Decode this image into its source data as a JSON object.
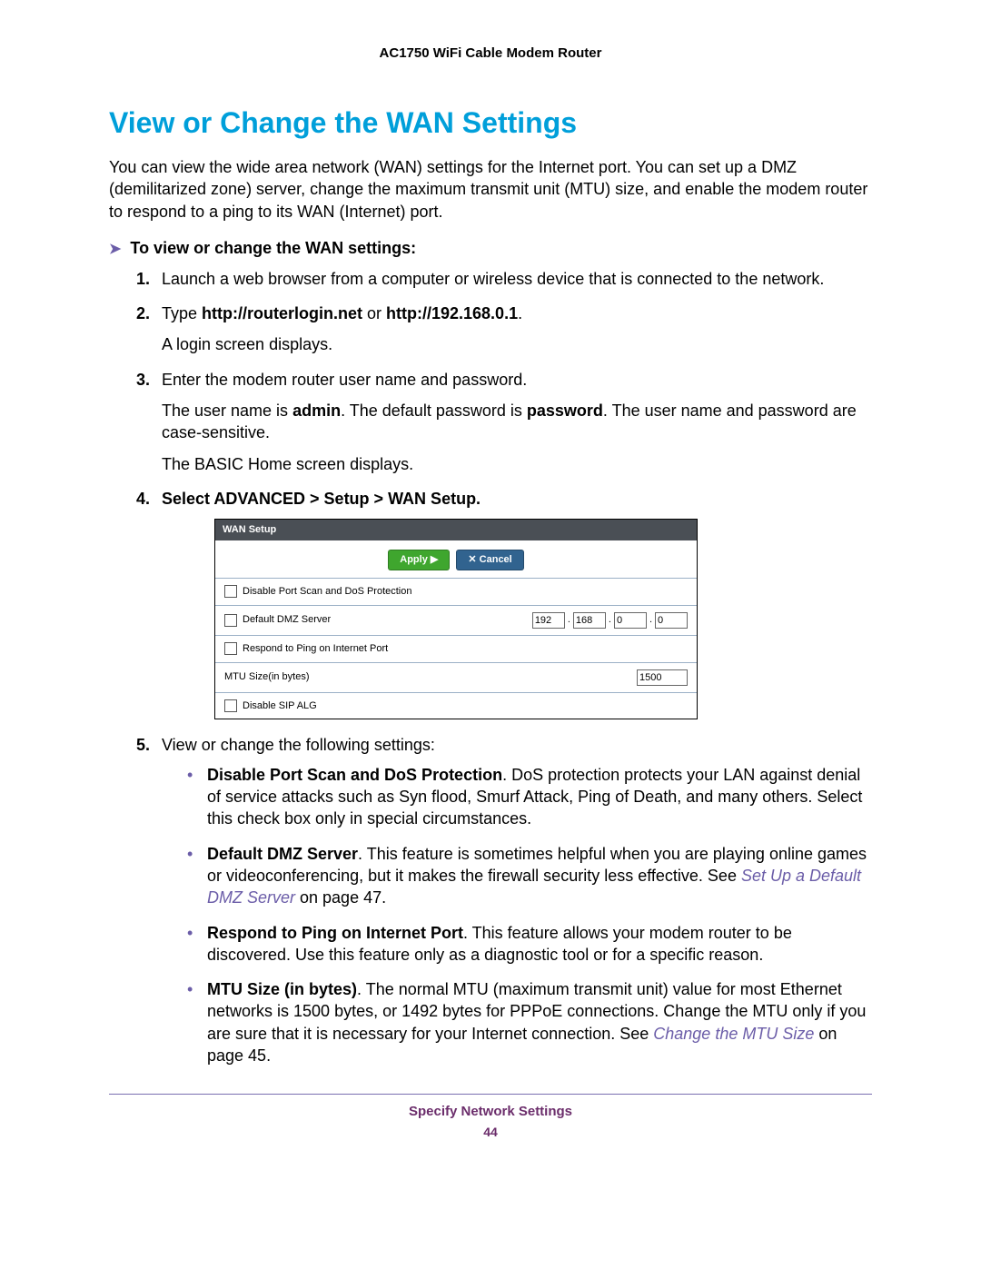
{
  "doc_header": "AC1750 WiFi Cable Modem Router",
  "section_title": "View or Change the WAN Settings",
  "intro": "You can view the wide area network (WAN) settings for the Internet port. You can set up a DMZ (demilitarized zone) server, change the maximum transmit unit (MTU) size, and enable the modem router to respond to a ping to its WAN (Internet) port.",
  "procedure_heading": "To view or change the WAN settings:",
  "steps": {
    "s1": {
      "num": "1.",
      "text": "Launch a web browser from a computer or wireless device that is connected to the network."
    },
    "s2": {
      "num": "2.",
      "prefix": "Type ",
      "bold1": "http://routerlogin.net",
      "mid": " or ",
      "bold2": "http://192.168.0.1",
      "suffix": ".",
      "p1": "A login screen displays."
    },
    "s3": {
      "num": "3.",
      "text": "Enter the modem router user name and password.",
      "p1a": "The user name is ",
      "p1b": "admin",
      "p1c": ". The default password is ",
      "p1d": "password",
      "p1e": ". The user name and password are case-sensitive.",
      "p2": "The BASIC Home screen displays."
    },
    "s4": {
      "num": "4.",
      "bold": "Select ADVANCED > Setup > WAN Setup."
    },
    "s5": {
      "num": "5.",
      "text": "View or change the following settings:"
    }
  },
  "figure": {
    "title": "WAN Setup",
    "apply": "Apply ▶",
    "cancel": "✕ Cancel",
    "row1": "Disable Port Scan and DoS Protection",
    "row2": "Default DMZ Server",
    "ip": {
      "a": "192",
      "b": "168",
      "c": "0",
      "d": "0"
    },
    "row3": "Respond to Ping on Internet Port",
    "row4": "MTU Size(in bytes)",
    "mtu": "1500",
    "row5": "Disable SIP ALG"
  },
  "bullets": {
    "b1": {
      "bold": "Disable Port Scan and DoS Protection",
      "text": ". DoS protection protects your LAN against denial of service attacks such as Syn flood, Smurf Attack, Ping of Death, and many others. Select this check box only in special circumstances."
    },
    "b2": {
      "bold": "Default DMZ Server",
      "text1": ". This feature is sometimes helpful when you are playing online games or videoconferencing, but it makes the firewall security less effective. See ",
      "xref": "Set Up a Default DMZ Server",
      "text2": " on page 47."
    },
    "b3": {
      "bold": "Respond to Ping on Internet Port",
      "text": ". This feature allows your modem router to be discovered. Use this feature only as a diagnostic tool or for a specific reason."
    },
    "b4": {
      "bold": "MTU Size (in bytes)",
      "text1": ". The normal MTU (maximum transmit unit) value for most Ethernet networks is 1500 bytes, or 1492 bytes for PPPoE connections. Change the MTU only if you are sure that it is necessary for your Internet connection. See ",
      "xref": "Change the MTU Size",
      "text2": " on page 45."
    }
  },
  "footer_title": "Specify Network Settings",
  "page_number": "44"
}
